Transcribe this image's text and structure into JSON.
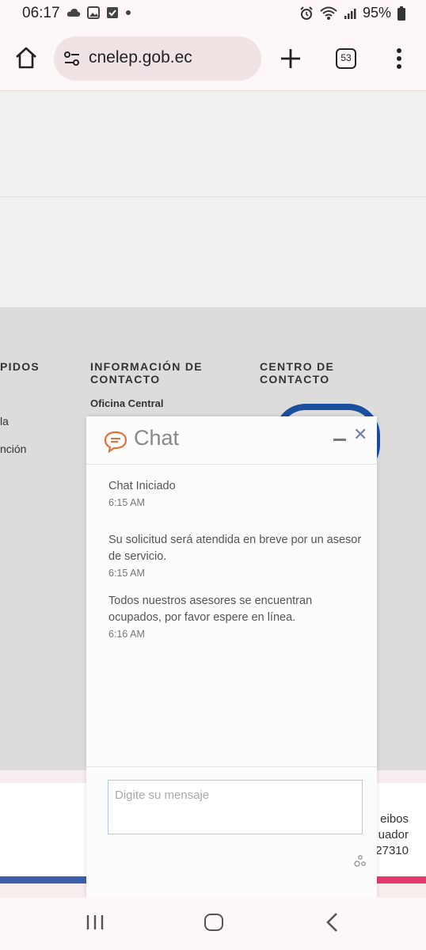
{
  "status_bar": {
    "time": "06:17",
    "battery": "95%",
    "left_icons": [
      "cloud-icon",
      "image-icon",
      "checkbox-icon",
      "dot-icon"
    ],
    "right_icons": [
      "alarm-icon",
      "wifi-icon",
      "signal-icon",
      "battery-icon"
    ]
  },
  "browser": {
    "url": "cnelep.gob.ec",
    "tab_count": "53"
  },
  "footer": {
    "col1_title": "PIDOS",
    "col1_links": [
      "la",
      "nción"
    ],
    "col2_title_line1": "INFORMACIÓN DE",
    "col2_title_line2": "CONTACTO",
    "col2_subtitle": "Oficina Central",
    "col3_title_line1": "CENTRO DE",
    "col3_title_line2": "CONTACTO",
    "address_lines": [
      "eibos",
      "uador",
      "27310"
    ],
    "colors": {
      "footer_bg": "#dcdcdc",
      "accent_blue": "#1a4fa0",
      "accent_pink": "#e43a6b"
    }
  },
  "chat": {
    "title": "Chat",
    "messages": [
      {
        "text": "Chat Iniciado",
        "time": "6:15 AM"
      },
      {
        "text": "Su solicitud será atendida en breve por un asesor de servicio.",
        "time": "6:15 AM"
      },
      {
        "text": "Todos nuestros asesores se encuentran ocupados, por favor espere en línea.",
        "time": "6:16 AM"
      }
    ],
    "input_placeholder": "Digite su mensaje",
    "colors": {
      "logo": "#e8703a",
      "close": "#6e7fa3",
      "input_border": "#b3c7e5"
    }
  }
}
